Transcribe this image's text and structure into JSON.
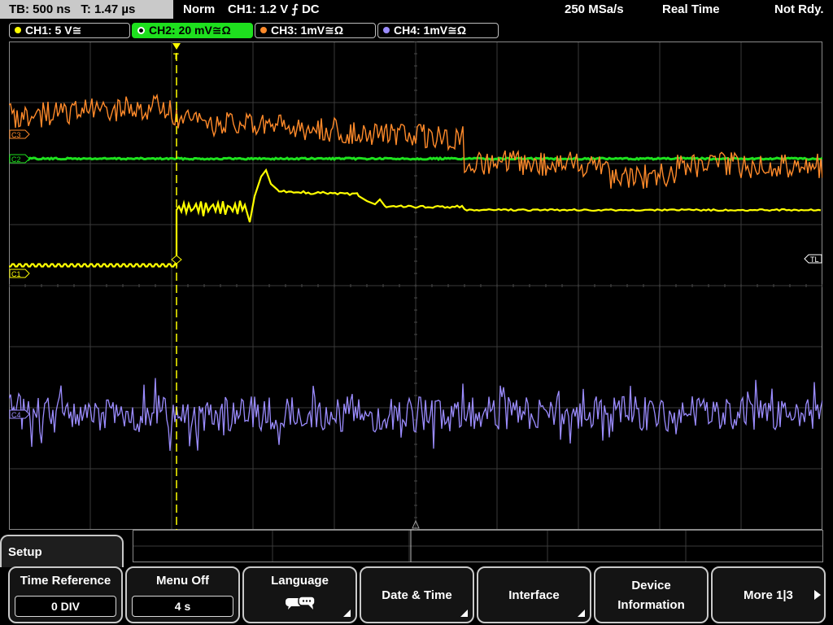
{
  "status_bar": {
    "timebase": "TB: 500 ns",
    "time_position": "T: 1.47 µs",
    "trigger_mode": "Norm",
    "trigger_info": "CH1: 1.2 V ⨍ DC",
    "sample_rate": "250 MSa/s",
    "acquisition": "Real Time",
    "state": "Not Rdy."
  },
  "channels": [
    {
      "label": "CH1: 5 V≅",
      "color": "#ffff00"
    },
    {
      "label": "CH2: 20 mV≅Ω",
      "color": "#1ee01e",
      "active": true
    },
    {
      "label": "CH3: 1mV≅Ω",
      "color": "#ff8a2a"
    },
    {
      "label": "CH4: 1mV≅Ω",
      "color": "#9b8cff"
    }
  ],
  "markers": {
    "ch1": "C1",
    "ch2": "C2",
    "ch3": "C3",
    "ch4": "C4",
    "trigger_level": "TL",
    "trigger_position": "T"
  },
  "menu": {
    "title": "Setup",
    "softkeys": [
      {
        "label": "Time Reference",
        "value": "0 DIV"
      },
      {
        "label": "Menu Off",
        "value": "4 s"
      },
      {
        "label": "Language",
        "icon": "speech-bubbles-icon"
      },
      {
        "label": "Date & Time"
      },
      {
        "label": "Interface"
      },
      {
        "label_line1": "Device",
        "label_line2": "Information"
      },
      {
        "label": "More 1|3"
      }
    ]
  },
  "colors": {
    "ch1": "#ffff00",
    "ch2": "#1ee01e",
    "ch3": "#ff8a2a",
    "ch4": "#9b8cff",
    "grid": "#3a3a3a",
    "panel": "#c9c9c9"
  }
}
